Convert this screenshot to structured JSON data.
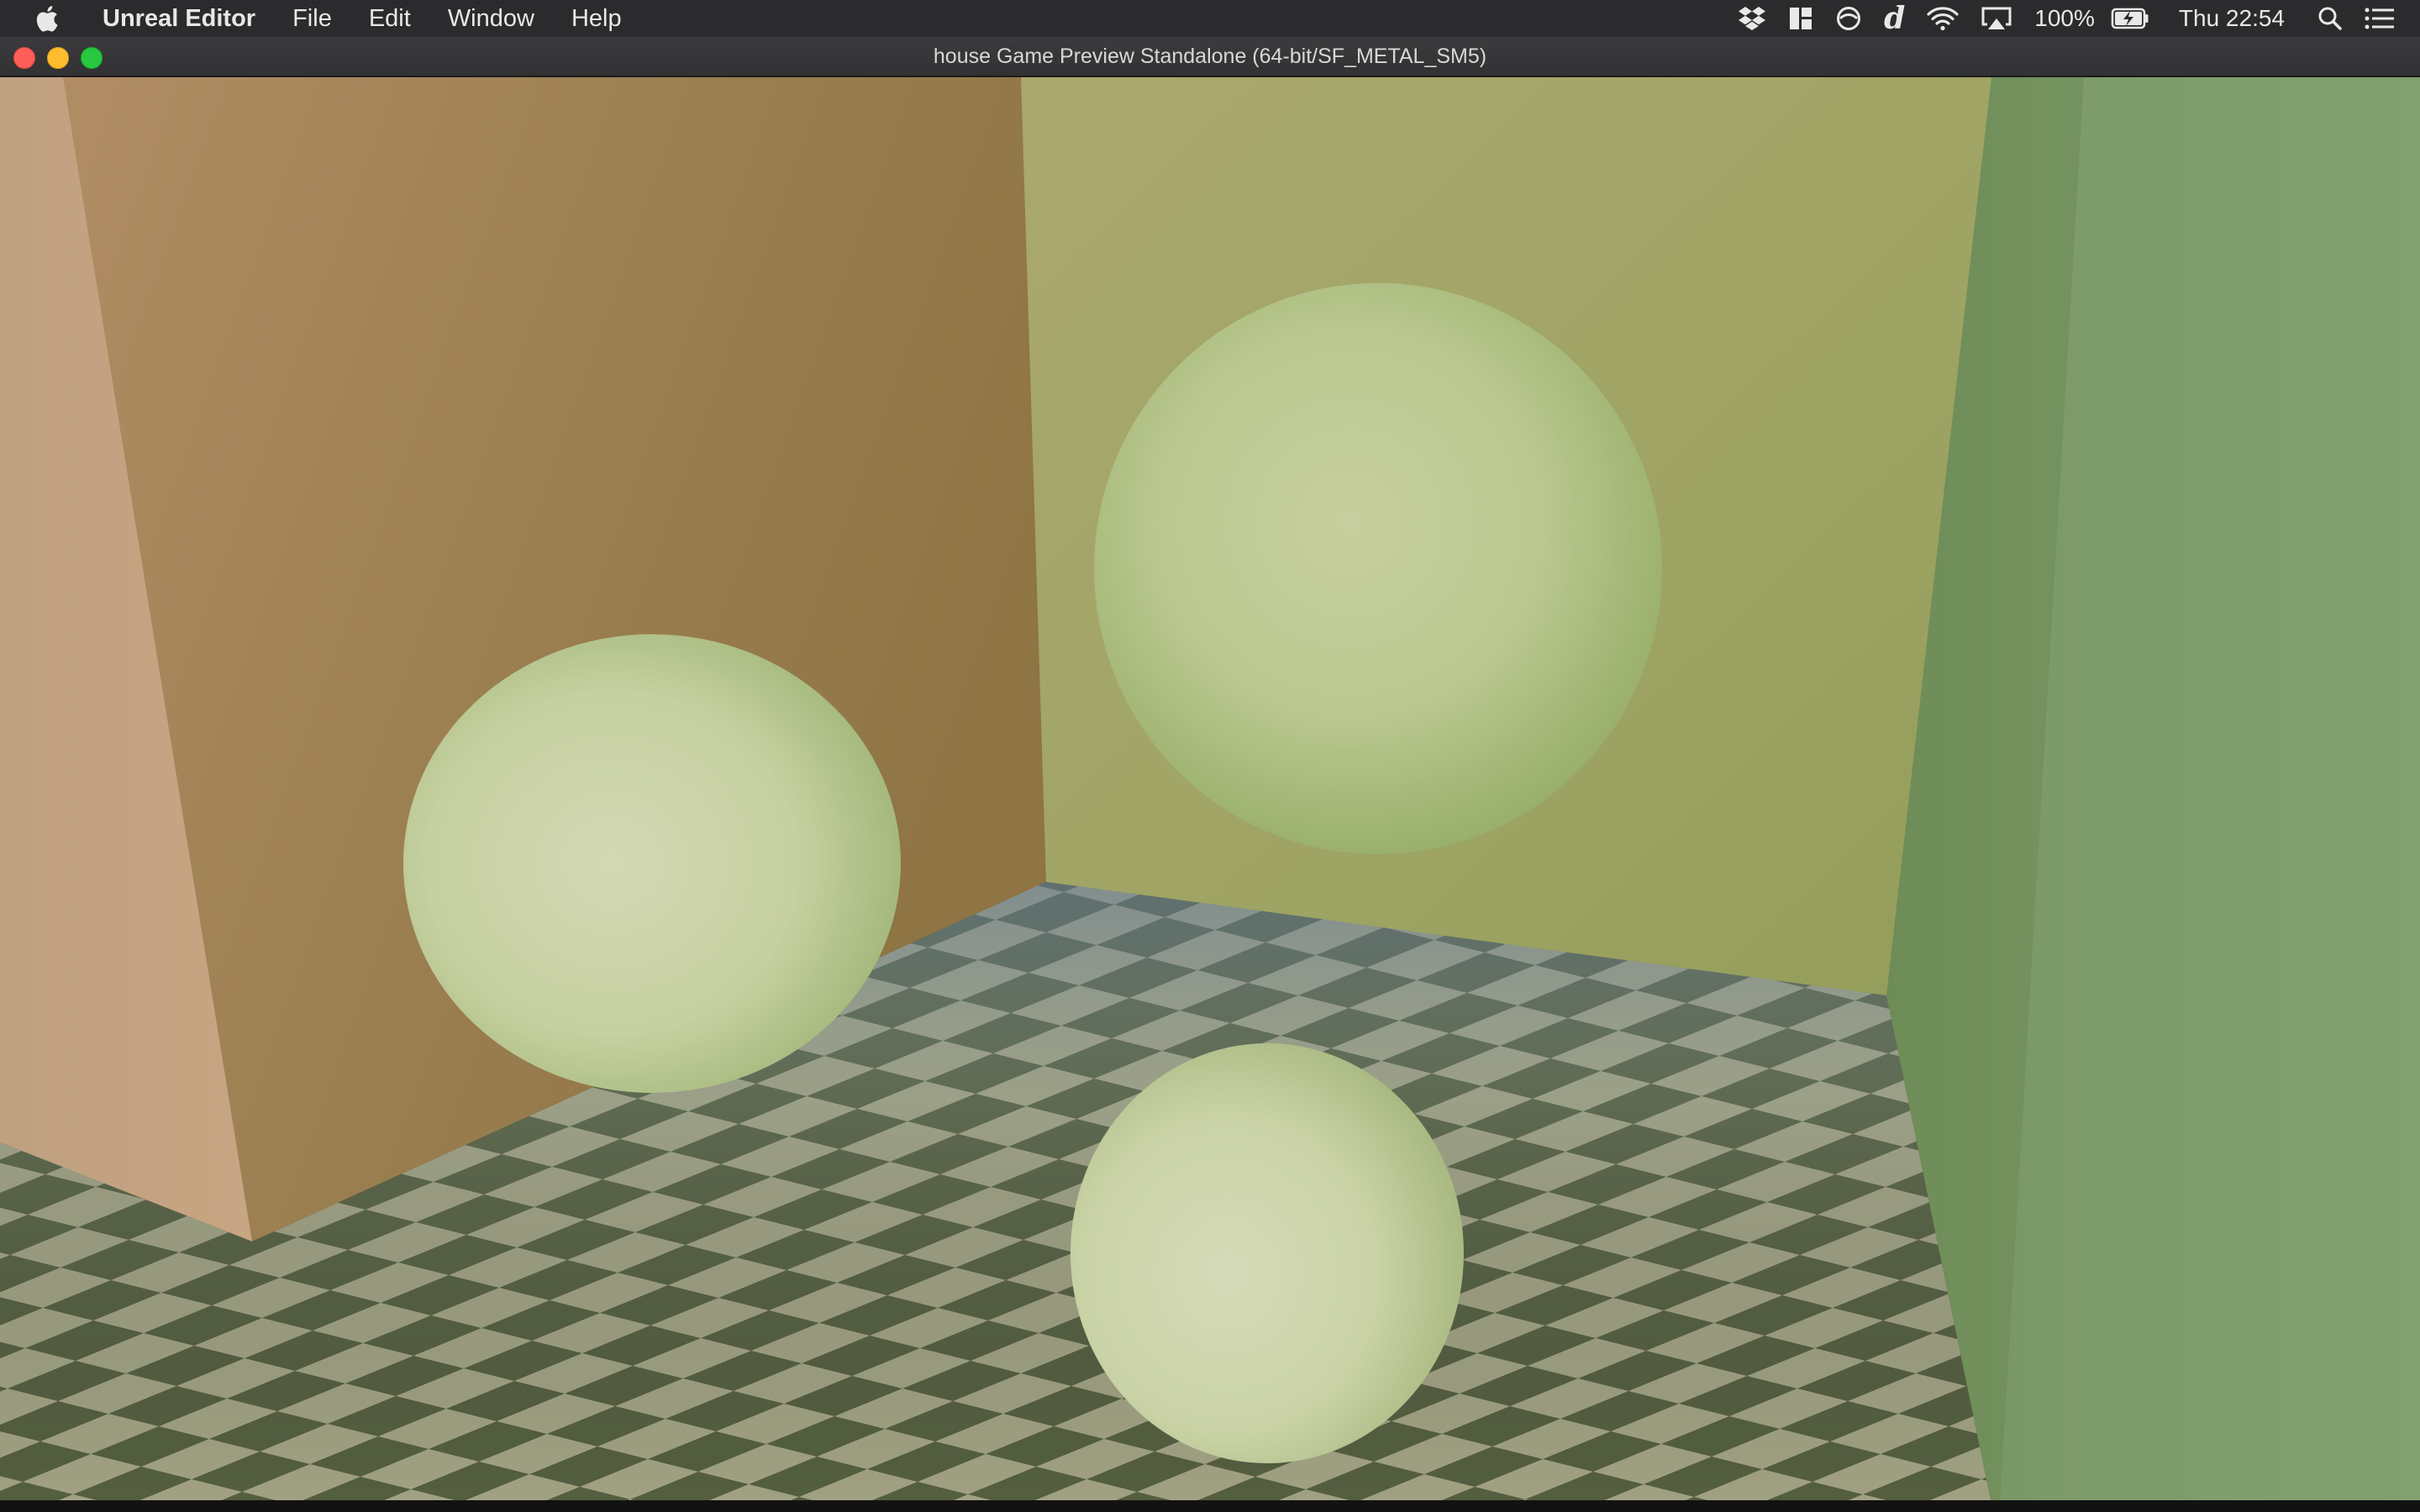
{
  "menubar": {
    "app_name": "Unreal Editor",
    "items": [
      "File",
      "Edit",
      "Window",
      "Help"
    ],
    "icons": [
      "apple-icon",
      "dropbox-icon",
      "layout-icon",
      "sync-icon",
      "d-app-icon",
      "wifi-icon",
      "airplay-icon",
      "battery-icon",
      "search-icon",
      "list-icon"
    ],
    "d_glyph": "d",
    "battery_percent": "100%",
    "clock": "Thu 22:54"
  },
  "window": {
    "title": "house Game Preview Standalone (64-bit/SF_METAL_SM5)"
  },
  "scene": {
    "description_colors": {
      "left_wall": "#9a7f52",
      "back_wall": "#a6a86c",
      "right_wall": "#7c9a6a",
      "sphere": "#ccd4a8",
      "floor_light": "#a8a886",
      "floor_dark": "#56603e"
    }
  }
}
